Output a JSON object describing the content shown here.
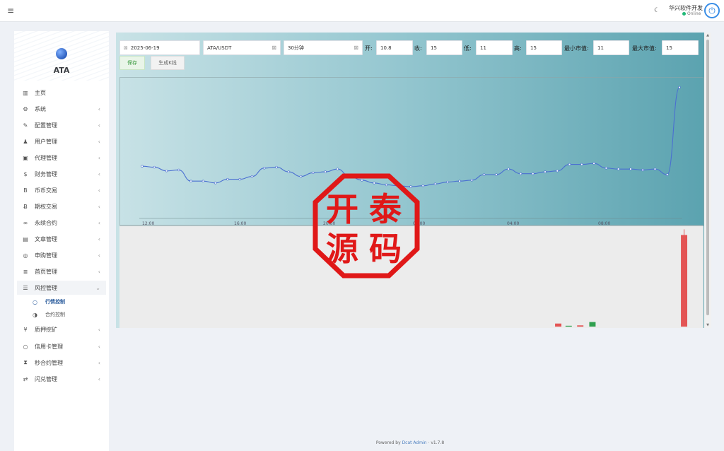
{
  "header": {
    "menu_icon": "menu-icon",
    "theme_icon": "moon-icon",
    "user_name": "华兴软件开发",
    "user_status": "Online",
    "power_icon": "power-icon",
    "power_glyph": "⏻"
  },
  "sidebar": {
    "logo_text": "ATA",
    "items": [
      {
        "label": "主页",
        "icon": "chart-icon",
        "glyph": "▥",
        "chevron": false
      },
      {
        "label": "系统",
        "icon": "gear-icon",
        "glyph": "⚙",
        "chevron": true
      },
      {
        "label": "配置管理",
        "icon": "wrench-icon",
        "glyph": "✎",
        "chevron": true
      },
      {
        "label": "用户管理",
        "icon": "users-icon",
        "glyph": "♟",
        "chevron": true
      },
      {
        "label": "代理管理",
        "icon": "id-card-icon",
        "glyph": "▣",
        "chevron": true
      },
      {
        "label": "财务管理",
        "icon": "dollar-icon",
        "glyph": "$",
        "chevron": true
      },
      {
        "label": "币币交易",
        "icon": "bitcoin-icon",
        "glyph": "B",
        "chevron": true
      },
      {
        "label": "期权交易",
        "icon": "bitcoin-icon",
        "glyph": "Ƀ",
        "chevron": true
      },
      {
        "label": "永续合约",
        "icon": "link-icon",
        "glyph": "∞",
        "chevron": true
      },
      {
        "label": "文章管理",
        "icon": "newspaper-icon",
        "glyph": "▤",
        "chevron": true
      },
      {
        "label": "申购管理",
        "icon": "lifebuoy-icon",
        "glyph": "◎",
        "chevron": true
      },
      {
        "label": "首页管理",
        "icon": "list-icon",
        "glyph": "≣",
        "chevron": true
      },
      {
        "label": "风控管理",
        "icon": "list-alt-icon",
        "glyph": "☰",
        "chevron": "down"
      },
      {
        "label": "质押挖矿",
        "icon": "yen-icon",
        "glyph": "¥",
        "chevron": true
      },
      {
        "label": "信用卡管理",
        "icon": "circle-icon",
        "glyph": "○",
        "chevron": true
      },
      {
        "label": "秒合约管理",
        "icon": "hourglass-icon",
        "glyph": "⧗",
        "chevron": true
      },
      {
        "label": "闪兑管理",
        "icon": "exchange-icon",
        "glyph": "⇄",
        "chevron": true
      }
    ],
    "sub_items": [
      {
        "label": "行情控制",
        "icon": "circle-outline-icon",
        "glyph": "○",
        "active": true
      },
      {
        "label": "合约控制",
        "icon": "half-circle-icon",
        "glyph": "◑",
        "active": false
      }
    ]
  },
  "form": {
    "date": "2025-06-19",
    "pair": "ATA/USDT",
    "interval": "30分钟",
    "open_label": "开:",
    "open_value": "10.8",
    "close_label": "收:",
    "close_value": "15",
    "low_label": "低:",
    "low_value": "11",
    "high_label": "高:",
    "high_value": "15",
    "min_mcap_label": "最小市值:",
    "min_mcap_value": "11",
    "max_mcap_label": "最大市值:",
    "max_mcap_value": "15",
    "save_label": "保存",
    "generate_label": "生成K线",
    "clear_icon": "⊠",
    "x_icon": "⊠"
  },
  "watermark": {
    "chars": [
      "开",
      "泰",
      "源",
      "码"
    ],
    "color": "#e01818"
  },
  "chart_data": {
    "type": "line",
    "x_tick_labels": [
      "12:00",
      "16:00",
      "20:00",
      "00:00",
      "04:00",
      "08:00"
    ],
    "points": [
      6.0,
      5.9,
      5.5,
      5.6,
      4.4,
      4.4,
      4.2,
      4.6,
      4.6,
      4.9,
      5.8,
      5.9,
      5.4,
      4.9,
      5.3,
      5.4,
      5.7,
      4.9,
      4.5,
      4.2,
      4.0,
      3.9,
      3.8,
      3.9,
      4.1,
      4.3,
      4.4,
      4.5,
      5.1,
      5.1,
      5.7,
      5.2,
      5.2,
      5.4,
      5.5,
      6.2,
      6.2,
      6.3,
      5.8,
      5.7,
      5.7,
      5.6,
      5.7,
      5.1,
      14.5
    ],
    "line_color": "#4a6fd1",
    "candles": [
      {
        "position": 0.753,
        "color": "#e35454",
        "up": false,
        "size": 0.03
      },
      {
        "position": 0.771,
        "color": "#2fa04f",
        "up": true,
        "size": 0.005
      },
      {
        "position": 0.791,
        "color": "#e35454",
        "up": false,
        "size": 0.012
      },
      {
        "position": 0.812,
        "color": "#2fa04f",
        "up": true,
        "size": 0.045
      },
      {
        "position": 0.97,
        "color": "#e35454",
        "up": false,
        "size": 0.9
      }
    ]
  },
  "footer": {
    "prefix": "Powered by",
    "link": "Dcat Admin",
    "separator": "·",
    "version": "v1.7.8"
  }
}
